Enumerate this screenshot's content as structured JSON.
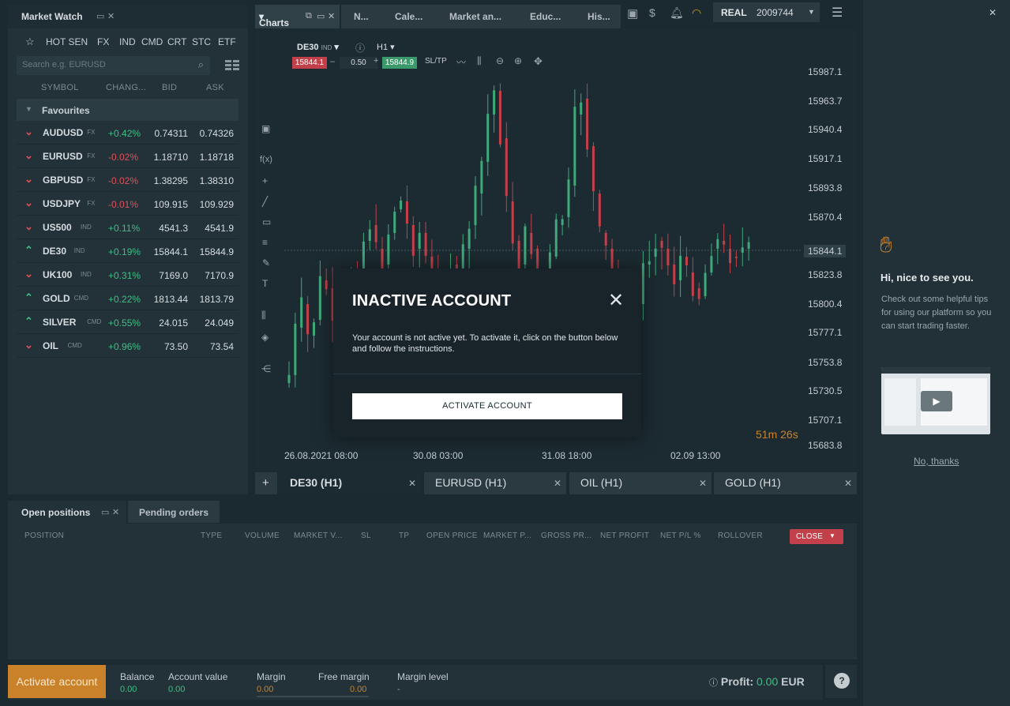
{
  "market_watch": {
    "title": "Market Watch",
    "tabs": [
      "HOT SEN",
      "FX",
      "IND",
      "CMD",
      "CRT",
      "STC",
      "ETF"
    ],
    "search_placeholder": "Search e.g. EURUSD",
    "columns": [
      "SYMBOL",
      "CHANG...",
      "BID",
      "ASK"
    ],
    "favourites_label": "Favourites",
    "rows": [
      {
        "symbol": "AUDUSD",
        "cls": "FX",
        "dir": "down",
        "change": "+0.42%",
        "bid": "0.74311",
        "ask": "0.74326"
      },
      {
        "symbol": "EURUSD",
        "cls": "FX",
        "dir": "down",
        "change": "-0.02%",
        "bid": "1.18710",
        "ask": "1.18718"
      },
      {
        "symbol": "GBPUSD",
        "cls": "FX",
        "dir": "down",
        "change": "-0.02%",
        "bid": "1.38295",
        "ask": "1.38310"
      },
      {
        "symbol": "USDJPY",
        "cls": "FX",
        "dir": "down",
        "change": "-0.01%",
        "bid": "109.915",
        "ask": "109.929"
      },
      {
        "symbol": "US500",
        "cls": "IND",
        "dir": "down",
        "change": "+0.11%",
        "bid": "4541.3",
        "ask": "4541.9"
      },
      {
        "symbol": "DE30",
        "cls": "IND",
        "dir": "up",
        "change": "+0.19%",
        "bid": "15844.1",
        "ask": "15844.9"
      },
      {
        "symbol": "UK100",
        "cls": "IND",
        "dir": "down",
        "change": "+0.31%",
        "bid": "7169.0",
        "ask": "7170.9"
      },
      {
        "symbol": "GOLD",
        "cls": "CMD",
        "dir": "up",
        "change": "+0.22%",
        "bid": "1813.44",
        "ask": "1813.79"
      },
      {
        "symbol": "SILVER",
        "cls": "CMD",
        "dir": "up",
        "change": "+0.55%",
        "bid": "24.015",
        "ask": "24.049"
      },
      {
        "symbol": "OIL",
        "cls": "CMD",
        "dir": "down",
        "change": "+0.96%",
        "bid": "73.50",
        "ask": "73.54"
      }
    ]
  },
  "top_tabs": {
    "charts": "Charts",
    "n": "N...",
    "cale": "Cale...",
    "market": "Market an...",
    "educ": "Educ...",
    "his": "His..."
  },
  "account": {
    "mode": "REAL",
    "number": "2009744"
  },
  "chart": {
    "symbol": "DE30",
    "symbol_cls": "IND",
    "timeframe": "H1",
    "sell_price": "15844.1",
    "volume": "0.50",
    "buy_price": "15844.9",
    "sltp": "SL/TP",
    "price_ticks": [
      "15987.1",
      "15963.7",
      "15940.4",
      "15917.1",
      "15893.8",
      "15870.4",
      "15844.1",
      "15823.8",
      "15800.4",
      "15777.1",
      "15753.8",
      "15730.5",
      "15707.1",
      "15683.8"
    ],
    "time_ticks": [
      "26.08.2021 08:00",
      "30.08 03:00",
      "31.08 18:00",
      "02.09 13:00"
    ],
    "countdown_min": "51m",
    "countdown_sec": "26s",
    "tabs": [
      "DE30 (H1)",
      "EURUSD (H1)",
      "OIL (H1)",
      "GOLD (H1)"
    ]
  },
  "modal": {
    "title": "INACTIVE ACCOUNT",
    "body": "Your account is not active yet. To activate it, click on the button below and follow the instructions.",
    "button": "ACTIVATE ACCOUNT"
  },
  "welcome": {
    "greeting": "Hi, nice to see you.",
    "text": "Check out some helpful tips for using our platform so you can start trading faster.",
    "no_thanks": "No, thanks"
  },
  "positions": {
    "tab_open": "Open positions",
    "tab_pending": "Pending orders",
    "columns": [
      "POSITION",
      "TYPE",
      "VOLUME",
      "MARKET V...",
      "SL",
      "TP",
      "OPEN PRICE",
      "MARKET P...",
      "GROSS PR...",
      "NET PROFIT",
      "NET P/L %",
      "ROLLOVER"
    ],
    "close_label": "CLOSE"
  },
  "status_bar": {
    "activate": "Activate account",
    "balance_label": "Balance",
    "balance": "0.00",
    "account_value_label": "Account value",
    "account_value": "0.00",
    "margin_label": "Margin",
    "margin": "0.00",
    "free_margin_label": "Free margin",
    "free_margin": "0.00",
    "margin_level_label": "Margin level",
    "margin_level": "-",
    "profit_label": "Profit:",
    "profit": "0.00",
    "currency": "EUR"
  },
  "colors": {
    "up": "#3fbf85",
    "down": "#e0505a",
    "accent": "#c9822a"
  }
}
